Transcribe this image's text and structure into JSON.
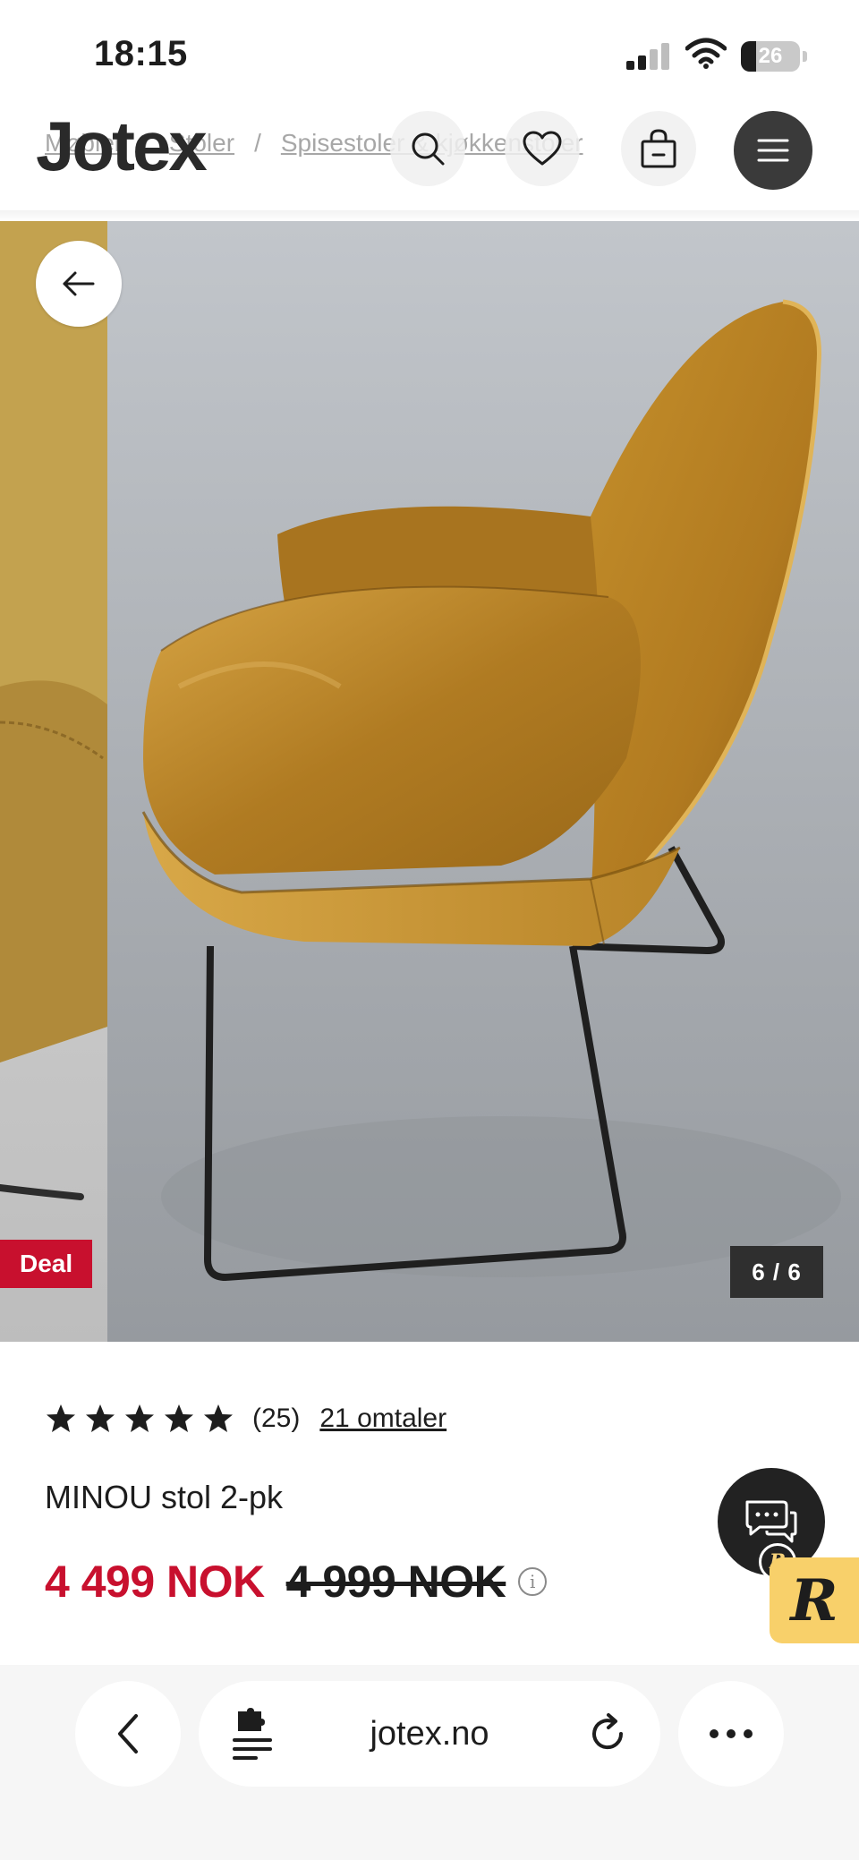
{
  "status_bar": {
    "time": "18:15",
    "battery": "26",
    "battery_level": 0.26
  },
  "header": {
    "logo": "Jotex",
    "breadcrumb": [
      "Møbler",
      "Stoler",
      "Spisestoler & kjøkkenstoler"
    ],
    "icons": [
      "search-icon",
      "heart-icon",
      "bag-icon",
      "menu-icon"
    ]
  },
  "gallery": {
    "badge": "Deal",
    "counter": "6 / 6",
    "current_image": 6,
    "total_images": 6
  },
  "product": {
    "rating": 5,
    "rating_count": "(25)",
    "reviews_link": "21 omtaler",
    "title": "MINOU stol 2-pk",
    "price_now": "4 499 NOK",
    "price_old": "4 999 NOK",
    "info_glyph": "i"
  },
  "chat": {
    "badge_letter": "R"
  },
  "browser": {
    "url": "jotex.no"
  },
  "colors": {
    "accent_red": "#c8102e",
    "text": "#1d1d1d",
    "chair_gold": "#c8962f",
    "badge_yellow": "#f8d06a"
  }
}
